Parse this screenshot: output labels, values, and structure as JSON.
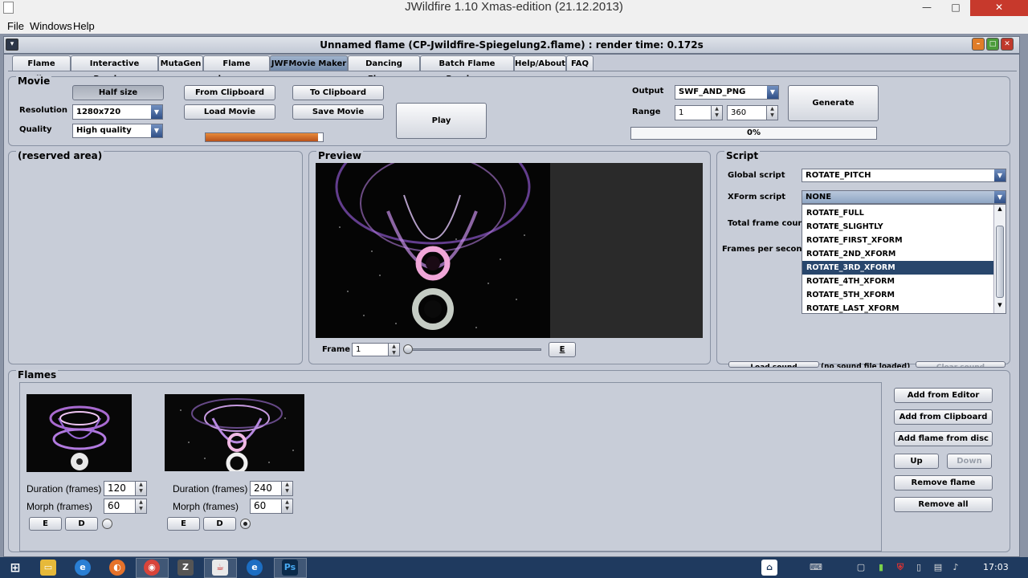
{
  "window": {
    "title": "JWildfire 1.10 Xmas-edition (21.12.2013)",
    "minimize": "—",
    "maximize": "□",
    "close": "✕"
  },
  "menubar": [
    "File",
    "Windows",
    "Help"
  ],
  "internal_frame": {
    "title": "Unnamed flame (CP-Jwildfire-Spiegelung2.flame) : render time: 0.172s"
  },
  "tabs": [
    "Flame Editor",
    "Interactive Renderer",
    "MutaGen",
    "Flame browser",
    "JWFMovie Maker",
    "Dancing Flames",
    "Batch Flame Renderer",
    "Help/About",
    "FAQ"
  ],
  "active_tab": "JWFMovie Maker",
  "movie": {
    "title": "Movie",
    "half_size": "Half size",
    "resolution_label": "Resolution",
    "resolution_value": "1280x720",
    "quality_label": "Quality",
    "quality_value": "High quality",
    "from_clipboard": "From Clipboard",
    "to_clipboard": "To Clipboard",
    "load_movie": "Load Movie",
    "save_movie": "Save Movie",
    "play": "Play",
    "output_label": "Output",
    "output_value": "SWF_AND_PNG",
    "range_label": "Range",
    "range_from": "1",
    "range_to": "360",
    "generate": "Generate",
    "progress_text": "0%",
    "progress_value": 0
  },
  "reserved_area": {
    "title": "(reserved area)"
  },
  "preview": {
    "title": "Preview",
    "frame_label": "Frame",
    "frame_value": "1",
    "edit_btn": "E"
  },
  "script": {
    "title": "Script",
    "global_label": "Global script",
    "global_value": "ROTATE_PITCH",
    "xform_label": "XForm script",
    "xform_value": "NONE",
    "total_frame_count_label": "Total frame count",
    "fps_label": "Frames per second",
    "xform_options": [
      "ROTATE_FULL",
      "ROTATE_SLIGHTLY",
      "ROTATE_FIRST_XFORM",
      "ROTATE_2ND_XFORM",
      "ROTATE_3RD_XFORM",
      "ROTATE_4TH_XFORM",
      "ROTATE_5TH_XFORM",
      "ROTATE_LAST_XFORM"
    ],
    "xform_selected": "ROTATE_3RD_XFORM",
    "load_sound": "Load sound",
    "no_sound": "(no sound file loaded)",
    "clear_sound": "Clear sound"
  },
  "flames": {
    "title": "Flames",
    "items": [
      {
        "duration_label": "Duration (frames)",
        "duration": "120",
        "morph_label": "Morph (frames)",
        "morph": "60",
        "e": "E",
        "d": "D",
        "selected": false
      },
      {
        "duration_label": "Duration (frames)",
        "duration": "240",
        "morph_label": "Morph (frames)",
        "morph": "60",
        "e": "E",
        "d": "D",
        "selected": true
      }
    ],
    "add_from_editor": "Add from Editor",
    "add_from_clipboard": "Add from Clipboard",
    "add_from_disc": "Add flame from disc",
    "up": "Up",
    "down": "Down",
    "remove_flame": "Remove flame",
    "remove_all": "Remove all"
  },
  "taskbar": {
    "clock": "17:03",
    "ps_label": "Ps"
  }
}
